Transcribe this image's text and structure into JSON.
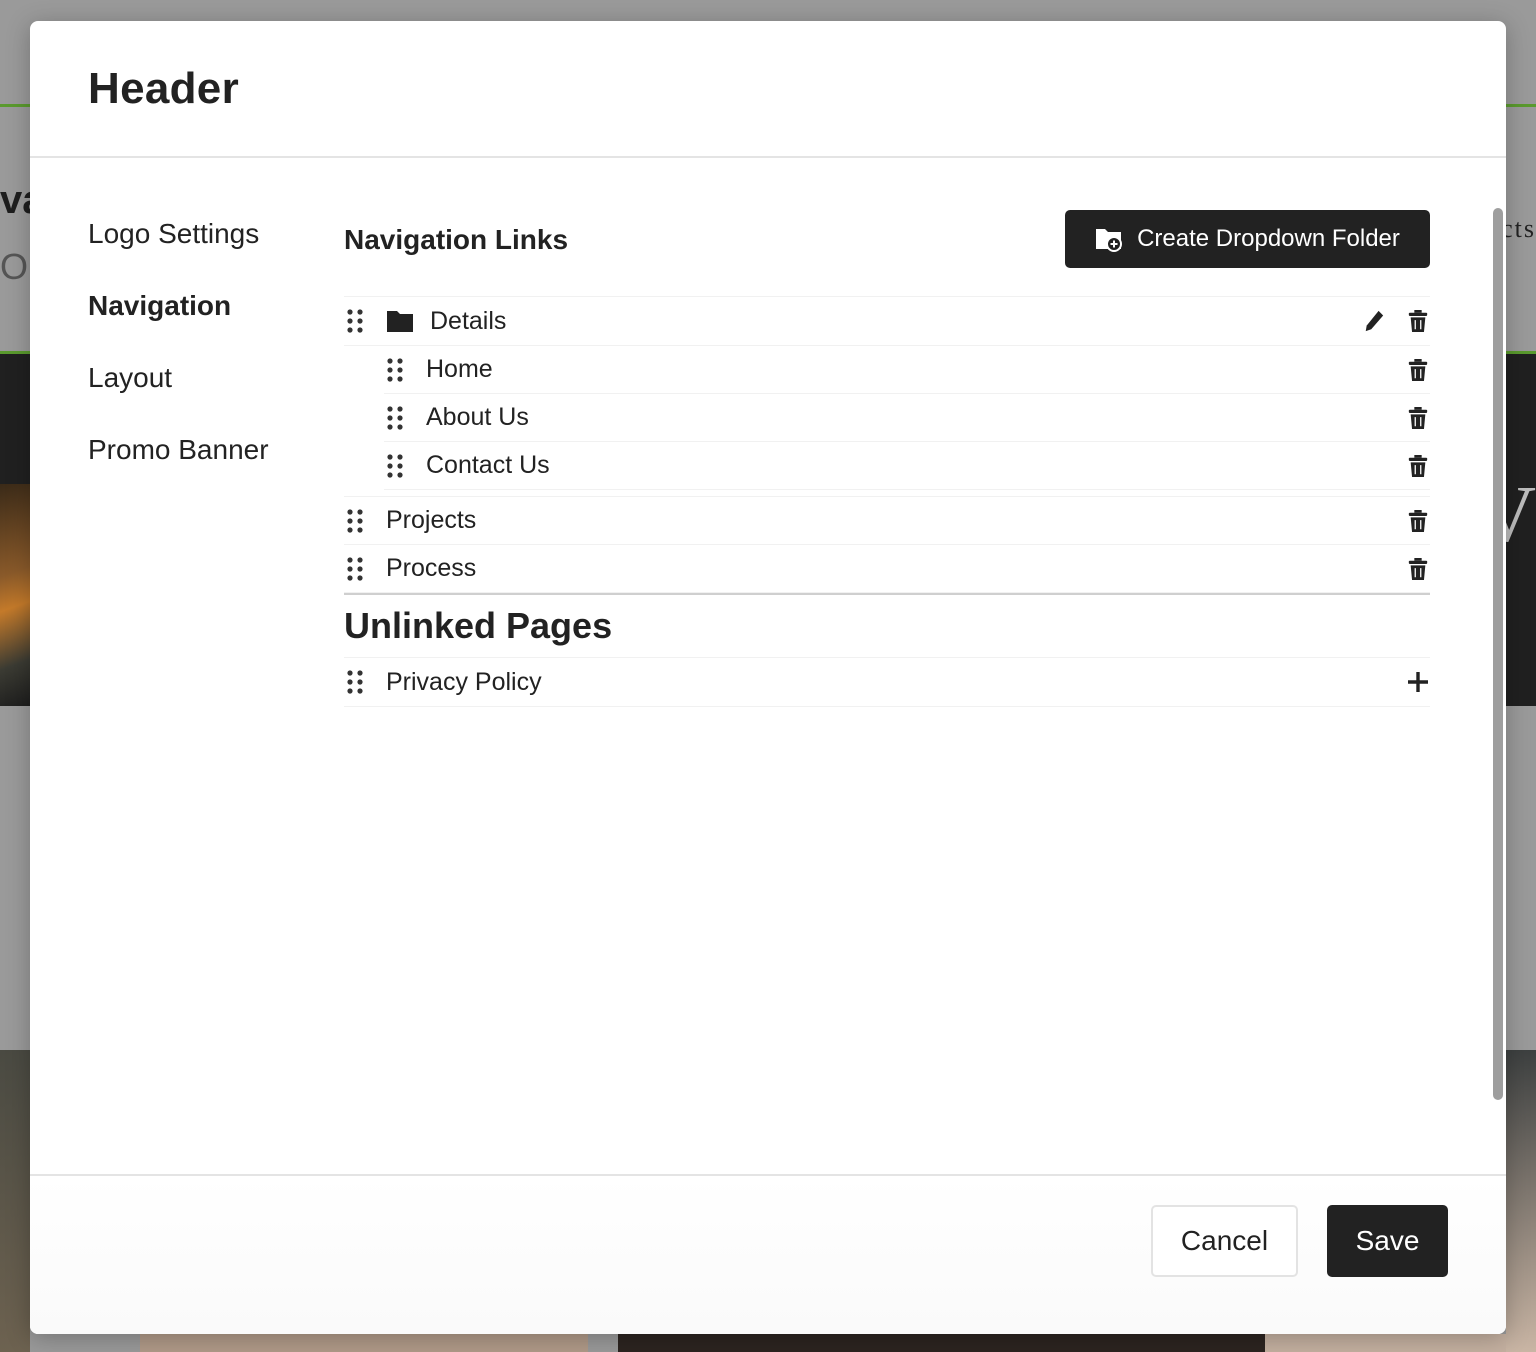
{
  "background": {
    "left_text_1": "va",
    "left_text_2": "OU",
    "right_text": "cts",
    "right_serif_letter": "V"
  },
  "modal": {
    "title": "Header",
    "side_nav": [
      {
        "label": "Logo Settings",
        "active": false
      },
      {
        "label": "Navigation",
        "active": true
      },
      {
        "label": "Layout",
        "active": false
      },
      {
        "label": "Promo Banner",
        "active": false
      }
    ],
    "navigation_links": {
      "title": "Navigation Links",
      "create_button_label": "Create Dropdown Folder",
      "folder": {
        "label": "Details",
        "children": [
          "Home",
          "About Us",
          "Contact Us"
        ]
      },
      "items": [
        "Projects",
        "Process"
      ]
    },
    "unlinked_pages": {
      "title": "Unlinked Pages",
      "items": [
        "Privacy Policy"
      ]
    },
    "footer": {
      "cancel_label": "Cancel",
      "save_label": "Save"
    }
  },
  "colors": {
    "accent_dark": "#222222",
    "backdrop": "#9a9a9a",
    "brand_green": "#5a9a2e"
  },
  "icons": {
    "drag": "grip-dots-icon",
    "folder": "folder-icon",
    "edit": "pencil-icon",
    "delete": "trash-icon",
    "add": "plus-icon",
    "create_folder": "folder-plus-icon"
  }
}
